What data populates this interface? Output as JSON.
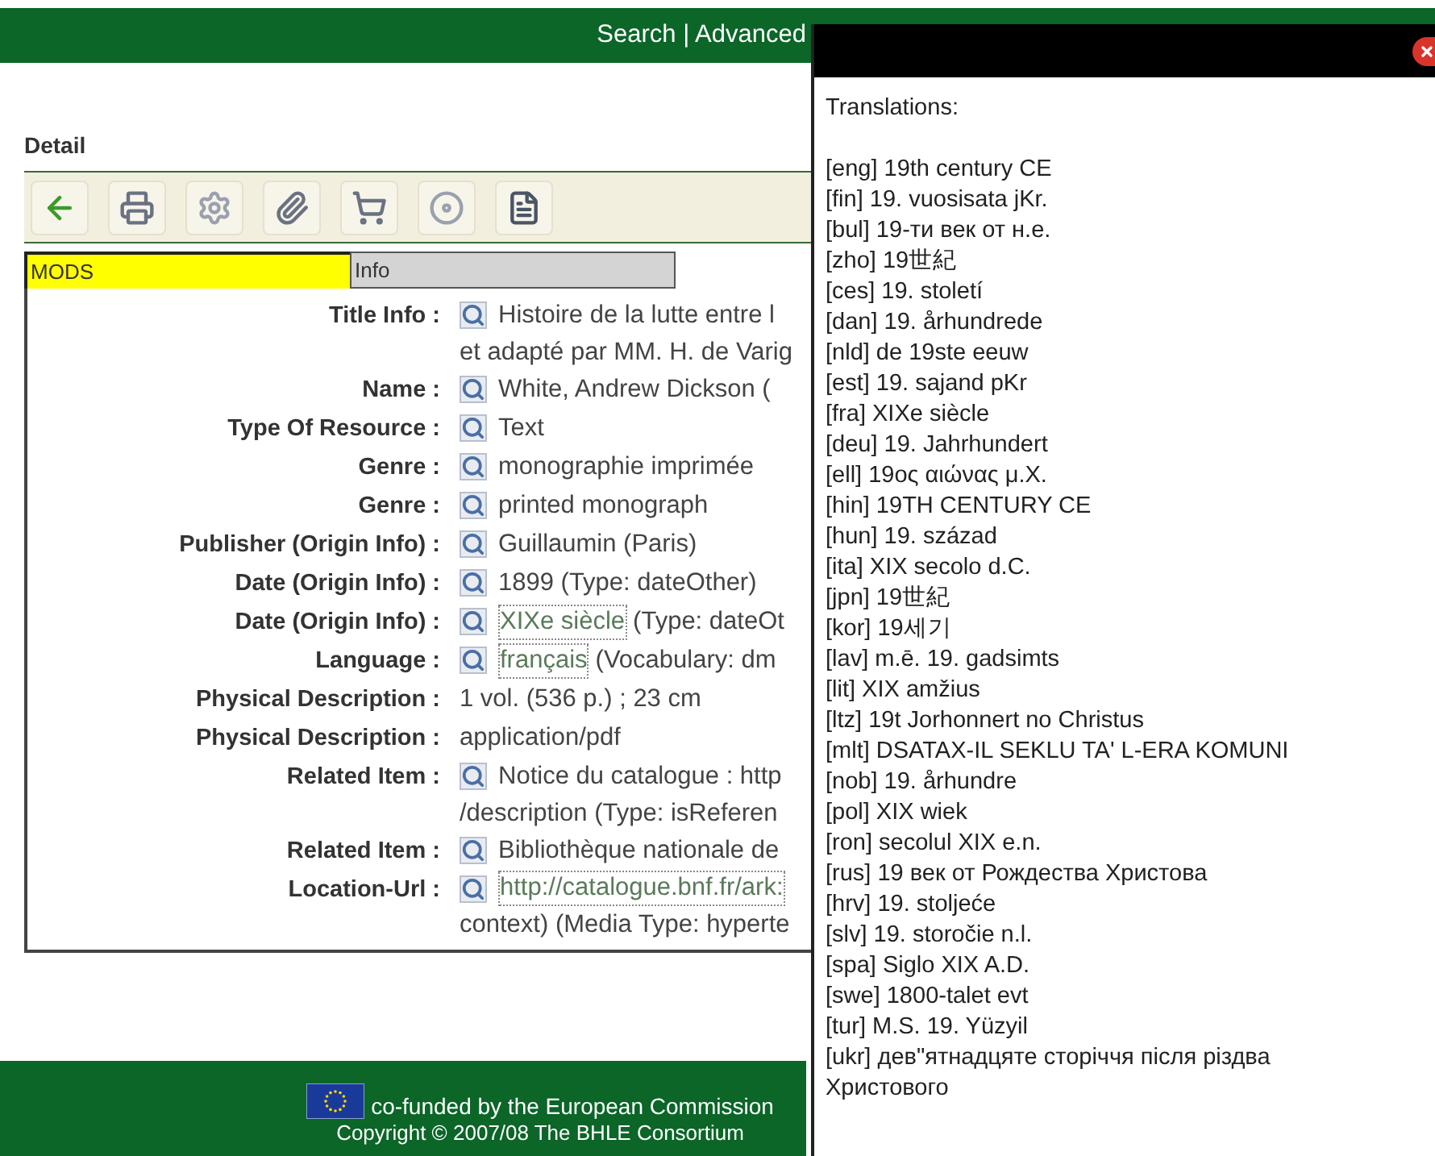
{
  "header": {
    "nav": "Search | Advanced"
  },
  "page": {
    "title": "Detail"
  },
  "toolbar": [
    {
      "kind": "back"
    },
    {
      "kind": "print"
    },
    {
      "kind": "settings"
    },
    {
      "kind": "attach"
    },
    {
      "kind": "cart"
    },
    {
      "kind": "disc"
    },
    {
      "kind": "document"
    }
  ],
  "tabs": [
    {
      "label": "MODS",
      "selected": true
    },
    {
      "label": "Info",
      "selected": false
    }
  ],
  "fields": [
    {
      "label": "Title Info :",
      "icon": true,
      "lines": [
        "Histoire de la lutte entre l",
        "et adapté par MM. H. de Varig"
      ]
    },
    {
      "label": "Name :",
      "icon": true,
      "lines": [
        "White, Andrew Dickson ("
      ]
    },
    {
      "label": "Type Of Resource :",
      "icon": true,
      "lines": [
        "Text"
      ]
    },
    {
      "label": "Genre :",
      "icon": true,
      "lines": [
        "monographie imprimée"
      ]
    },
    {
      "label": "Genre :",
      "icon": true,
      "lines": [
        "printed monograph"
      ]
    },
    {
      "label": "Publisher (Origin Info) :",
      "icon": true,
      "lines": [
        "Guillaumin (Paris)"
      ]
    },
    {
      "label": "Date (Origin Info) :",
      "icon": true,
      "lines": [
        "1899 (Type: dateOther)"
      ]
    },
    {
      "label": "Date (Origin Info) :",
      "icon": true,
      "lines": [
        {
          "link": "XIXe siècle",
          "text": "(Type: dateOt"
        }
      ]
    },
    {
      "label": "Language :",
      "icon": true,
      "lines": [
        {
          "link": "français",
          "text": "(Vocabulary: dm"
        }
      ]
    },
    {
      "label": "Physical Description :",
      "icon": false,
      "lines": [
        "1 vol. (536 p.) ; 23 cm"
      ]
    },
    {
      "label": "Physical Description :",
      "icon": false,
      "lines": [
        "application/pdf"
      ]
    },
    {
      "label": "Related Item :",
      "icon": true,
      "lines": [
        "Notice du catalogue : http",
        "/description (Type: isReferen"
      ]
    },
    {
      "label": "Related Item :",
      "icon": true,
      "lines": [
        "Bibliothèque nationale de"
      ]
    },
    {
      "label": "Location-Url :",
      "icon": true,
      "lines": [
        {
          "link": "http://catalogue.bnf.fr/ark:"
        },
        "context) (Media Type: hyperte"
      ]
    }
  ],
  "footer": {
    "funding": "co-funded by the European Commission",
    "copyright": "Copyright © 2007/08 The BHLE Consortium"
  },
  "popup": {
    "heading": "Translations:",
    "translations": [
      "[eng] 19th century CE",
      "[fin] 19. vuosisata jKr.",
      "[bul] 19-ти век от н.е.",
      "[zho] 19世紀",
      "[ces] 19. století",
      "[dan] 19. århundrede",
      "[nld] de 19ste eeuw",
      "[est] 19. sajand pKr",
      "[fra] XIXe siècle",
      "[deu] 19. Jahrhundert",
      "[ell] 19ος αιώνας μ.Χ.",
      "[hin] 19TH CENTURY CE",
      "[hun] 19. század",
      "[ita] XIX secolo d.C.",
      "[jpn] 19世紀",
      "[kor] 19세기",
      "[lav] m.ē. 19. gadsimts",
      "[lit] XIX amžius",
      "[ltz] 19t Jorhonnert no Christus",
      "[mlt] DSATAX-IL SEKLU TA' L-ERA KOMUNI",
      "[nob] 19. århundre",
      "[pol] XIX wiek",
      "[ron] secolul XIX e.n.",
      "[rus] 19 век от Рождества Христова",
      "[hrv] 19. stoljeće",
      "[slv] 19. storočie n.l.",
      "[spa] Siglo XIX A.D.",
      "[swe] 1800-talet evt",
      "[tur] M.S. 19. Yüzyil",
      "[ukr] дев\"ятнадцяте сторіччя після різдва Христового"
    ]
  }
}
